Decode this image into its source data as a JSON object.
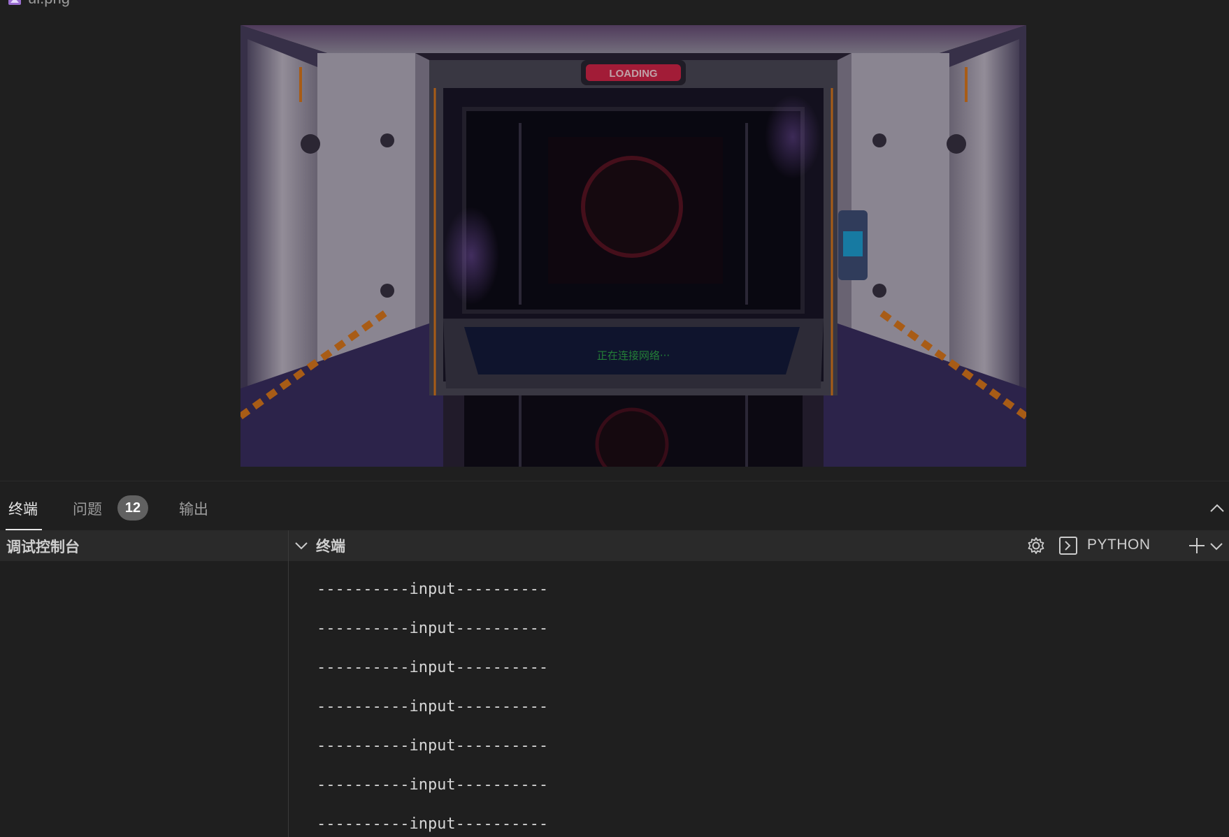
{
  "file_tab": {
    "name": "ui.png",
    "icon": "image-file-icon"
  },
  "image": {
    "badge_text": "LOADING",
    "status_text": "正在连接网络···"
  },
  "panel": {
    "tabs": [
      {
        "label": "终端",
        "active": true
      },
      {
        "label": "问题",
        "count": "12"
      },
      {
        "label": "输出"
      }
    ],
    "left_title": "调试控制台",
    "terminal_title": "终端",
    "shell_label": "PYTHON",
    "icons": [
      "chevron-down-icon",
      "gear-icon",
      "terminal-icon",
      "plus-icon",
      "chevron-up-icon"
    ]
  },
  "terminal": {
    "lines": [
      "----------input----------",
      "----------input----------",
      "----------input----------",
      "----------input----------",
      "----------input----------",
      "----------input----------",
      "----------input----------"
    ]
  },
  "colors": {
    "background": "#1f1f1f",
    "header": "#2a2a2a",
    "badge": "#616161",
    "loading_red": "#d8264a",
    "status_green": "#2fa84a",
    "orange_stripe": "#e07b1e",
    "hull_white": "#cfc7d6",
    "hull_purple": "#3b2f63"
  }
}
